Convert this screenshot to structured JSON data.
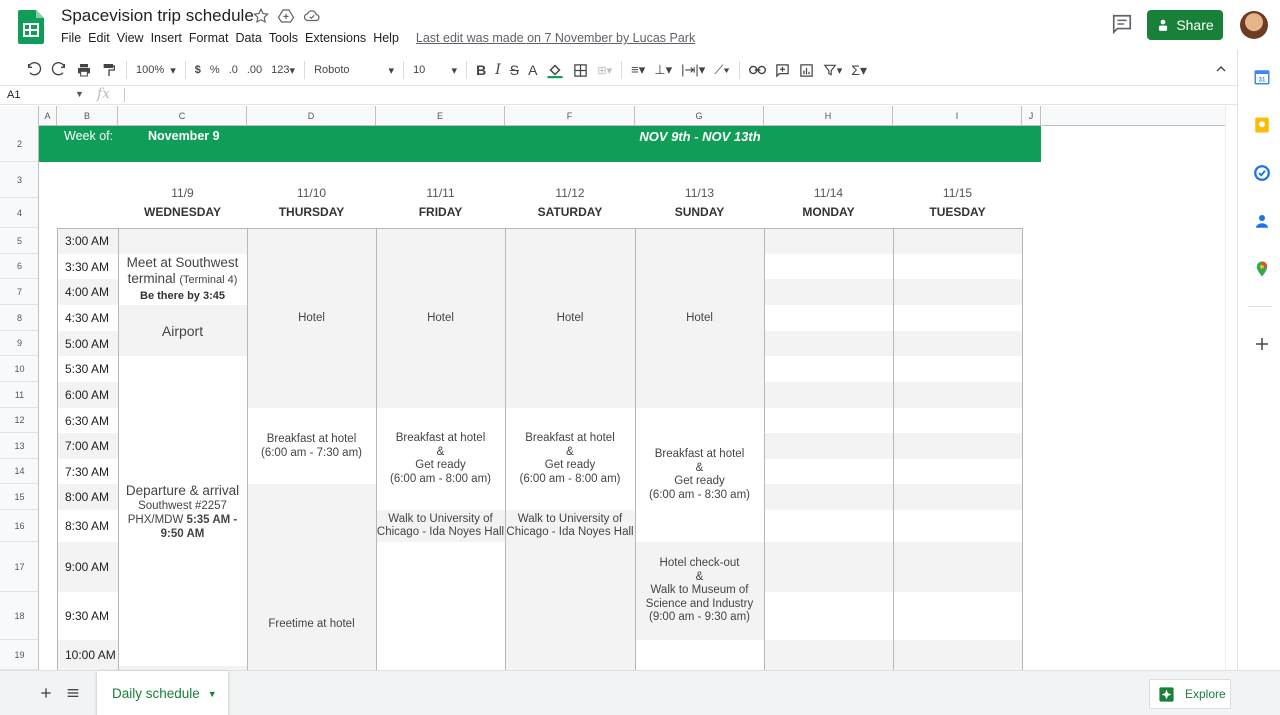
{
  "header": {
    "title": "Spacevision trip schedule",
    "menu": [
      "File",
      "Edit",
      "View",
      "Insert",
      "Format",
      "Data",
      "Tools",
      "Extensions",
      "Help"
    ],
    "last_edit": "Last edit was made on 7 November by Lucas Park",
    "share_label": "Share"
  },
  "toolbar": {
    "zoom": "100%",
    "currency": "$",
    "percent": "%",
    "dec_decrease": ".0",
    "dec_increase": ".00",
    "format_more": "123",
    "font": "Roboto",
    "font_size": "10"
  },
  "formula_bar": {
    "name_box": "A1",
    "fx": "fx"
  },
  "columns": [
    "A",
    "B",
    "C",
    "D",
    "E",
    "F",
    "G",
    "H",
    "I",
    "J"
  ],
  "rows": [
    "2",
    "3",
    "4",
    "5",
    "6",
    "7",
    "8",
    "9",
    "10",
    "11",
    "12",
    "13",
    "14",
    "15",
    "16",
    "17",
    "18",
    "19"
  ],
  "sheet": {
    "banner": {
      "week_label": "Week of:",
      "week_value": "November 9",
      "range": "NOV 9th - NOV 13th"
    },
    "day_dates": [
      "11/9",
      "11/10",
      "11/11",
      "11/12",
      "11/13",
      "11/14",
      "11/15"
    ],
    "day_names": [
      "WEDNESDAY",
      "THURSDAY",
      "FRIDAY",
      "SATURDAY",
      "SUNDAY",
      "MONDAY",
      "TUESDAY"
    ],
    "times": [
      "3:00 AM",
      "3:30 AM",
      "4:00 AM",
      "4:30 AM",
      "5:00 AM",
      "5:30 AM",
      "6:00 AM",
      "6:30 AM",
      "7:00 AM",
      "7:30 AM",
      "8:00 AM",
      "8:30 AM",
      "9:00 AM",
      "9:30 AM",
      "10:00 AM"
    ],
    "wed": {
      "meet_line1": "Meet at Southwest",
      "meet_line2": "terminal",
      "meet_terminal": "(Terminal 4)",
      "meet_line3": "Be there by 3:45",
      "airport": "Airport",
      "dep_title": "Departure & arrival",
      "dep_flight": "Southwest #2257",
      "dep_route": "PHX/MDW",
      "dep_time1": "5:35 AM -",
      "dep_time2": "9:50 AM"
    },
    "thu": {
      "hotel": "Hotel",
      "breakfast": "Breakfast at hotel",
      "breakfast_time": "(6:00 am - 7:30 am)",
      "freetime": "Freetime at hotel"
    },
    "fri": {
      "hotel": "Hotel",
      "l1": "Breakfast at hotel",
      "l2": "&",
      "l3": "Get ready",
      "l4": "(6:00 am - 8:00 am)",
      "walk1": "Walk to University of",
      "walk2": "Chicago - Ida Noyes Hall"
    },
    "sat": {
      "hotel": "Hotel",
      "l1": "Breakfast at hotel",
      "l2": "&",
      "l3": "Get ready",
      "l4": "(6:00 am - 8:00 am)",
      "walk1": "Walk to University of",
      "walk2": "Chicago - Ida Noyes Hall"
    },
    "sun": {
      "hotel": "Hotel",
      "l1": "Breakfast at hotel",
      "l2": "&",
      "l3": "Get ready",
      "l4": "(6:00 am - 8:30 am)",
      "c1": "Hotel check-out",
      "c2": "&",
      "c3": "Walk to Museum of",
      "c4": "Science and Industry",
      "c5": "(9:00 am - 9:30 am)"
    }
  },
  "bottom": {
    "tab_label": "Daily schedule",
    "explore_label": "Explore"
  },
  "colors": {
    "green": "#0f9d58",
    "share": "#188038",
    "alt_row": "#f3f3f3"
  },
  "icons": [
    "star-icon",
    "drive-move-icon",
    "cloud-saved-icon",
    "comments-icon",
    "calendar-icon",
    "keep-icon",
    "tasks-icon",
    "contacts-icon",
    "maps-icon",
    "add-icon"
  ]
}
